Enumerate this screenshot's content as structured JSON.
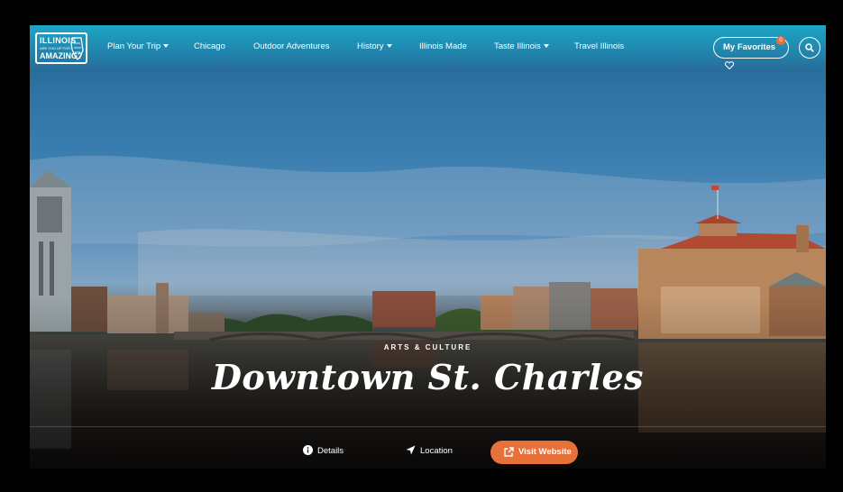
{
  "header": {
    "logo": {
      "line1": "ILLINOIS",
      "line2": "ARE YOU UP FOR",
      "line3": "AMAZING?"
    },
    "nav": [
      {
        "label": "Plan Your Trip",
        "dropdown": true
      },
      {
        "label": "Chicago",
        "dropdown": false
      },
      {
        "label": "Outdoor Adventures",
        "dropdown": false
      },
      {
        "label": "History",
        "dropdown": true
      },
      {
        "label": "Illinois Made",
        "dropdown": false
      },
      {
        "label": "Taste Illinois",
        "dropdown": true
      },
      {
        "label": "Travel Illinois",
        "dropdown": false
      }
    ],
    "favorites": {
      "label": "My Favorites",
      "count": "0",
      "icon": "heart-icon"
    },
    "search_icon": "search-icon"
  },
  "hero": {
    "eyebrow": "ARTS & CULTURE",
    "title": "Downtown St. Charles"
  },
  "actions": {
    "details": {
      "label": "Details",
      "icon": "info-icon"
    },
    "location": {
      "label": "Location",
      "icon": "location-arrow-icon"
    },
    "visit": {
      "label": "Visit Website",
      "icon": "external-link-icon"
    }
  },
  "colors": {
    "accent": "#e8703a",
    "nav_top": "#1caac8",
    "background": "#000000"
  }
}
